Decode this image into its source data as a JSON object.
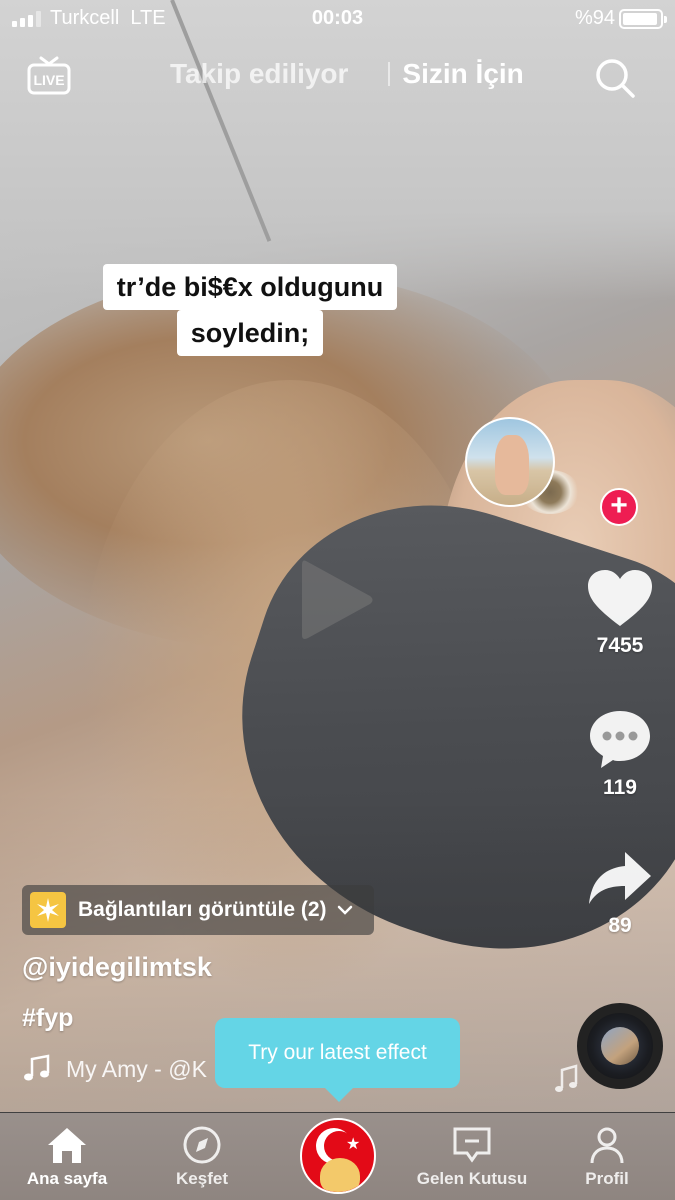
{
  "status_bar": {
    "carrier": "Turkcell",
    "network": "LTE",
    "time": "00:03",
    "battery_text": "%94",
    "battery_level": 0.94
  },
  "top_nav": {
    "live_icon": "live-tv-icon",
    "tab_following": "Takip ediliyor",
    "tab_for_you": "Sizin İçin",
    "search_icon": "search-icon"
  },
  "video": {
    "caption_line1": "tr’de bi$€x oldugunu",
    "caption_line2": "soyledin;"
  },
  "actions": {
    "likes": "7455",
    "comments": "119",
    "shares": "89"
  },
  "info": {
    "links_label": "Bağlantıları görüntüle (2)",
    "username": "@iyidegilimtsk",
    "hashtag": "#fyp",
    "music": "My Amy - @K"
  },
  "tooltip": "Try our latest effect",
  "tabbar": {
    "home": "Ana sayfa",
    "discover": "Keşfet",
    "inbox": "Gelen Kutusu",
    "profile": "Profil"
  },
  "colors": {
    "follow_red": "#ee1d52",
    "tooltip_cyan": "#64d5e6",
    "spark_yellow": "#f5c542"
  }
}
